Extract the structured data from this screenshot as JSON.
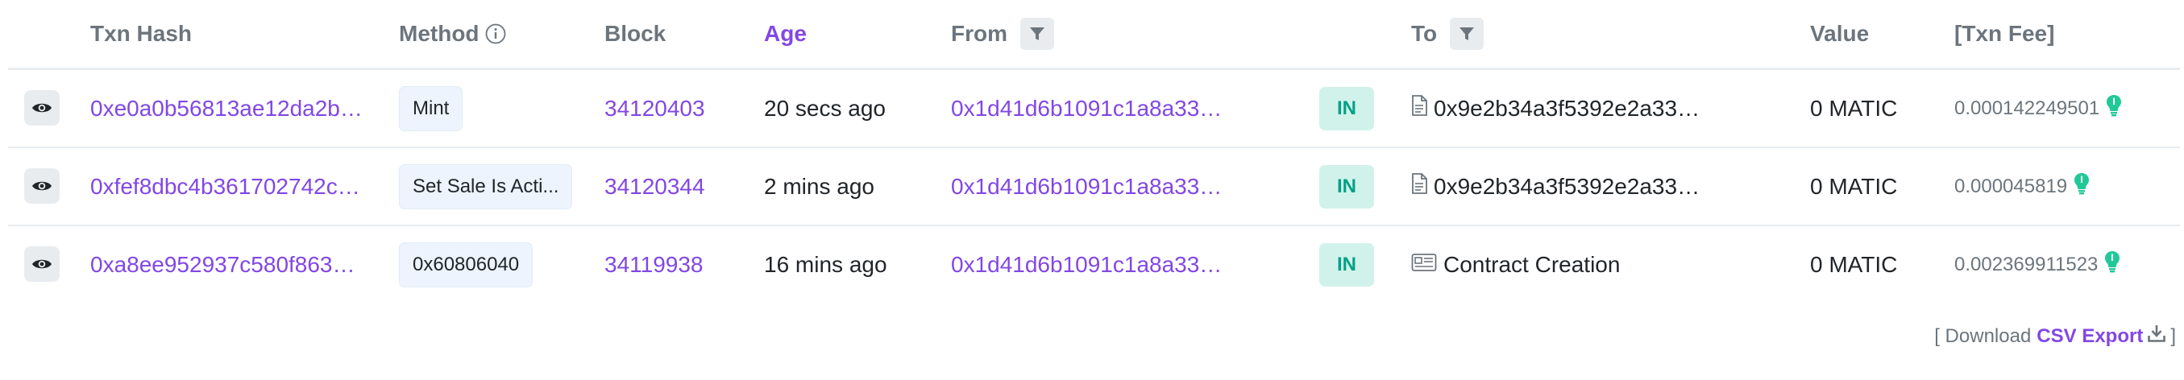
{
  "columns": {
    "txn_hash": "Txn Hash",
    "method": "Method",
    "block": "Block",
    "age": "Age",
    "from": "From",
    "to": "To",
    "value": "Value",
    "txn_fee": "[Txn Fee]"
  },
  "rows": [
    {
      "hash": "0xe0a0b56813ae12da2b…",
      "method": "Mint",
      "block": "34120403",
      "age": "20 secs ago",
      "from": "0x1d41d6b1091c1a8a33…",
      "direction": "IN",
      "to_icon": "contract-file-icon",
      "to": "0x9e2b34a3f5392e2a33…",
      "value": "0 MATIC",
      "fee": "0.000142249501"
    },
    {
      "hash": "0xfef8dbc4b361702742c…",
      "method": "Set Sale Is Acti...",
      "block": "34120344",
      "age": "2 mins ago",
      "from": "0x1d41d6b1091c1a8a33…",
      "direction": "IN",
      "to_icon": "contract-file-icon",
      "to": "0x9e2b34a3f5392e2a33…",
      "value": "0 MATIC",
      "fee": "0.000045819"
    },
    {
      "hash": "0xa8ee952937c580f863…",
      "method": "0x60806040",
      "block": "34119938",
      "age": "16 mins ago",
      "from": "0x1d41d6b1091c1a8a33…",
      "direction": "IN",
      "to_icon": "contract-creation-icon",
      "to": "Contract Creation",
      "value": "0 MATIC",
      "fee": "0.002369911523"
    }
  ],
  "footer": {
    "open_bracket": "[ Download",
    "csv_label": "CSV Export",
    "close_bracket": "]"
  },
  "colors": {
    "accent": "#8247e5",
    "in_badge_bg": "#d1f2ea",
    "in_badge_text": "#00a186",
    "gas_green": "#20c997",
    "muted": "#6c757d"
  }
}
